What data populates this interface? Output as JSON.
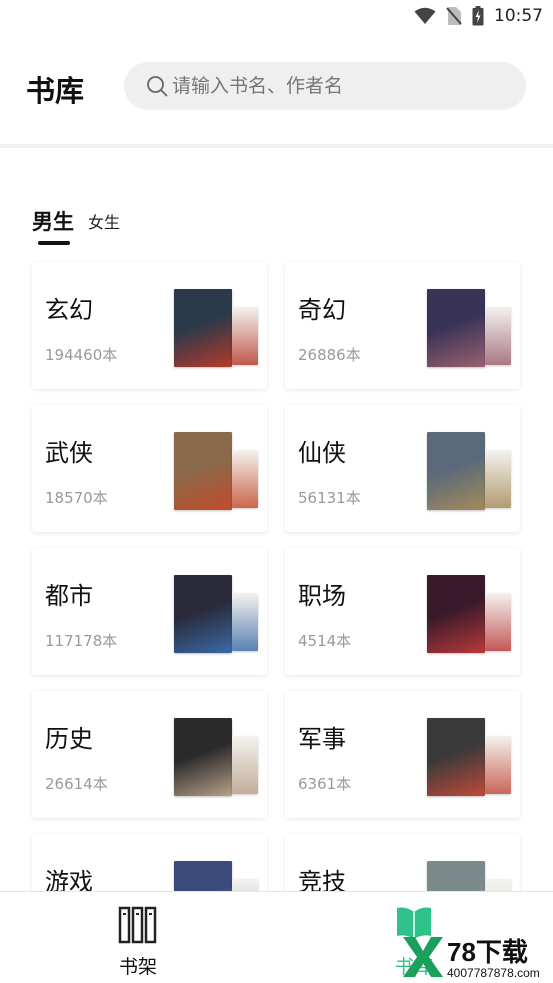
{
  "status_bar": {
    "time": "10:57"
  },
  "header": {
    "title": "书库",
    "search_placeholder": "请输入书名、作者名"
  },
  "tabs": [
    {
      "label": "男生",
      "active": true
    },
    {
      "label": "女生",
      "active": false
    }
  ],
  "categories": [
    {
      "name": "玄幻",
      "count": "194460本",
      "cover_colors": [
        "#2b3a4a",
        "#b43a2c"
      ]
    },
    {
      "name": "奇幻",
      "count": "26886本",
      "cover_colors": [
        "#3a3358",
        "#9a6070"
      ]
    },
    {
      "name": "武侠",
      "count": "18570本",
      "cover_colors": [
        "#8a6a4a",
        "#c24a2a"
      ]
    },
    {
      "name": "仙侠",
      "count": "56131本",
      "cover_colors": [
        "#5a6a7a",
        "#a48a5a"
      ]
    },
    {
      "name": "都市",
      "count": "117178本",
      "cover_colors": [
        "#2a2a3a",
        "#3a6aa8"
      ]
    },
    {
      "name": "职场",
      "count": "4514本",
      "cover_colors": [
        "#3a1a2a",
        "#b83a3a"
      ]
    },
    {
      "name": "历史",
      "count": "26614本",
      "cover_colors": [
        "#2a2a2a",
        "#b8a088"
      ]
    },
    {
      "name": "军事",
      "count": "6361本",
      "cover_colors": [
        "#3a3a3a",
        "#c04a3a"
      ]
    },
    {
      "name": "游戏",
      "count": "",
      "cover_colors": [
        "#3a4a7a",
        "#9aa8c0"
      ]
    },
    {
      "name": "竞技",
      "count": "",
      "cover_colors": [
        "#7a8a8a",
        "#c8d0d0"
      ]
    }
  ],
  "bottom_nav": {
    "items": [
      {
        "label": "书架",
        "icon": "bookshelf-icon"
      },
      {
        "label": "书库",
        "icon": "book-open-icon"
      }
    ]
  },
  "watermark": {
    "brand": "78下载",
    "url": "4007787878.com"
  },
  "colors": {
    "accent": "#2ec28a",
    "brand": "#1aa05a"
  }
}
